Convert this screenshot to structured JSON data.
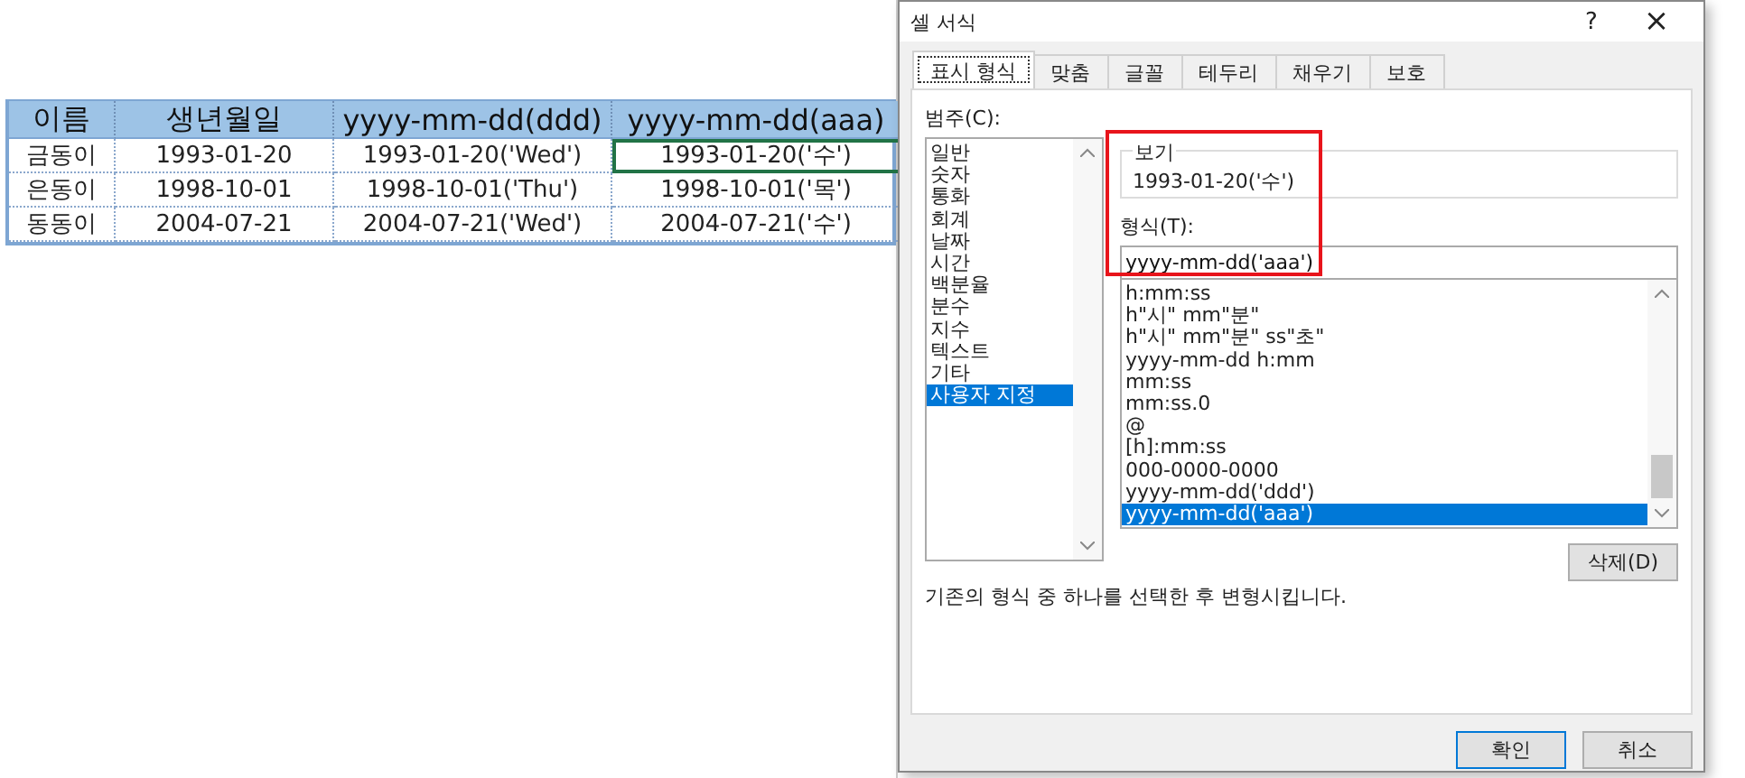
{
  "sheet": {
    "columns": [
      "이름",
      "생년월일",
      "yyyy-mm-dd(ddd)",
      "yyyy-mm-dd(aaa)"
    ],
    "rows": [
      {
        "cells": [
          {
            "text": "금동이",
            "selected": false
          },
          {
            "text": "1993-01-20",
            "selected": false
          },
          {
            "text": "1993-01-20('Wed')",
            "selected": false
          },
          {
            "text": "1993-01-20('수')",
            "selected": true
          }
        ]
      },
      {
        "cells": [
          {
            "text": "은동이",
            "selected": false
          },
          {
            "text": "1998-10-01",
            "selected": false
          },
          {
            "text": "1998-10-01('Thu')",
            "selected": false
          },
          {
            "text": "1998-10-01('목')",
            "selected": false
          }
        ]
      },
      {
        "cells": [
          {
            "text": "동동이",
            "selected": false
          },
          {
            "text": "2004-07-21",
            "selected": false
          },
          {
            "text": "2004-07-21('Wed')",
            "selected": false
          },
          {
            "text": "2004-07-21('수')",
            "selected": false
          }
        ]
      }
    ]
  },
  "dialog": {
    "title": "셀 서식",
    "help_button": "?",
    "close_button": "×",
    "tabs": [
      {
        "label": "표시 형식",
        "selected": true
      },
      {
        "label": "맞춤",
        "selected": false
      },
      {
        "label": "글꼴",
        "selected": false
      },
      {
        "label": "테두리",
        "selected": false
      },
      {
        "label": "채우기",
        "selected": false
      },
      {
        "label": "보호",
        "selected": false
      }
    ],
    "category_label": "범주(C):",
    "categories": [
      {
        "label": "일반",
        "selected": false
      },
      {
        "label": "숫자",
        "selected": false
      },
      {
        "label": "통화",
        "selected": false
      },
      {
        "label": "회계",
        "selected": false
      },
      {
        "label": "날짜",
        "selected": false
      },
      {
        "label": "시간",
        "selected": false
      },
      {
        "label": "백분율",
        "selected": false
      },
      {
        "label": "분수",
        "selected": false
      },
      {
        "label": "지수",
        "selected": false
      },
      {
        "label": "텍스트",
        "selected": false
      },
      {
        "label": "기타",
        "selected": false
      },
      {
        "label": "사용자 지정",
        "selected": true
      }
    ],
    "sample_label": "보기",
    "sample_value": "1993-01-20('수')",
    "type_label": "형식(T):",
    "type_value": "yyyy-mm-dd('aaa')",
    "highlight_box": true,
    "formats": [
      {
        "label": "h:mm:ss",
        "selected": false
      },
      {
        "label": "h\"시\" mm\"분\"",
        "selected": false
      },
      {
        "label": "h\"시\" mm\"분\" ss\"초\"",
        "selected": false
      },
      {
        "label": "yyyy-mm-dd h:mm",
        "selected": false
      },
      {
        "label": "mm:ss",
        "selected": false
      },
      {
        "label": "mm:ss.0",
        "selected": false
      },
      {
        "label": "@",
        "selected": false
      },
      {
        "label": "[h]:mm:ss",
        "selected": false
      },
      {
        "label": "000-0000-0000",
        "selected": false
      },
      {
        "label": "yyyy-mm-dd('ddd')",
        "selected": false
      },
      {
        "label": "yyyy-mm-dd('aaa')",
        "selected": true
      }
    ],
    "delete_button": "삭제(D)",
    "description": "기존의 형식 중 하나를 선택한 후 변형시킵니다.",
    "ok_button": "확인",
    "cancel_button": "취소"
  }
}
